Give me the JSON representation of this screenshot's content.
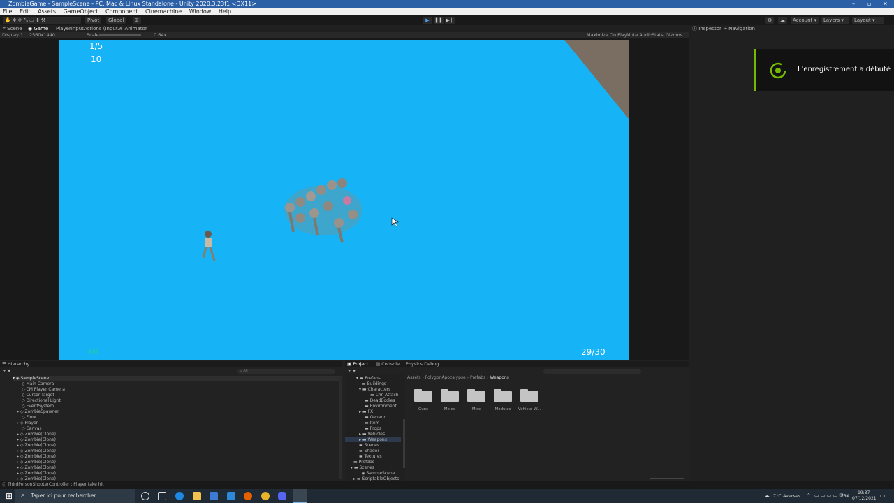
{
  "window": {
    "title": "ZombieGame - SampleScene - PC, Mac & Linux Standalone - Unity 2020.3.23f1 <DX11>"
  },
  "menu": [
    "File",
    "Edit",
    "Assets",
    "GameObject",
    "Component",
    "Cinemachine",
    "Window",
    "Help"
  ],
  "toolbar": {
    "pivot": "Pivot",
    "global": "Global",
    "account": "Account",
    "layers": "Layers",
    "layout": "Layout"
  },
  "tabs": {
    "scene": "Scene",
    "game": "Game",
    "input_actions": "PlayerInputActions (Input...",
    "animator": "Animator",
    "inspector": "Inspector",
    "navigation": "Navigation"
  },
  "gamebar": {
    "display": "Display 1",
    "resolution": "2560x1440",
    "scale_label": "Scale",
    "scale_value": "0.64x",
    "maximize": "Maximize On Play",
    "mute": "Mute Audio",
    "stats": "Stats",
    "gizmos": "Gizmos"
  },
  "game_hud": {
    "wave": "1/5",
    "count": "10",
    "ammo": "29/30",
    "bottom_left": "60"
  },
  "notification": {
    "text": "L'enregistrement a débuté"
  },
  "hierarchy": {
    "title": "Hierarchy",
    "search_placeholder": "All",
    "scene": "SampleScene",
    "items": [
      "Main Camera",
      "CM Player Camera",
      "Cursor Target",
      "Directional Light",
      "EventSystem",
      "ZombieSpawner",
      "Floor",
      "Player",
      "Canvas",
      "Zombie(Clone)",
      "Zombie(Clone)",
      "Zombie(Clone)",
      "Zombie(Clone)",
      "Zombie(Clone)",
      "Zombie(Clone)",
      "Zombie(Clone)",
      "Zombie(Clone)",
      "Zombie(Clone)"
    ]
  },
  "project": {
    "tabs": [
      "Project",
      "Console",
      "Physics Debug"
    ],
    "tree": [
      "Prefabs",
      "Buildings",
      "Characters",
      "Chr_Attach",
      "DeadBodies",
      "Environment",
      "FX",
      "Generic",
      "Item",
      "Props",
      "Vehicles",
      "Weapons",
      "Scenes",
      "Shader",
      "Textures",
      "Prefabs",
      "Scenes",
      "SampleScene",
      "ScriptableObjects"
    ],
    "breadcrumb": [
      "Assets",
      "PolygonApocalypse",
      "Prefabs",
      "Weapons"
    ],
    "folders": [
      "Guns",
      "Melee",
      "Misc",
      "Modules",
      "Vehicle_W..."
    ]
  },
  "status": {
    "message": "ThirdPersonShooterController : Player take hit"
  },
  "taskbar": {
    "search_placeholder": "Taper ici pour rechercher",
    "weather": "7°C  Averses",
    "lang": "FRA",
    "time": "19:37",
    "date": "07/12/2021"
  },
  "colors": {
    "game_bg": "#16b4f6",
    "unity_bg": "#191919",
    "titlebar": "#2b5fa6",
    "notif_accent": "#76b900"
  }
}
